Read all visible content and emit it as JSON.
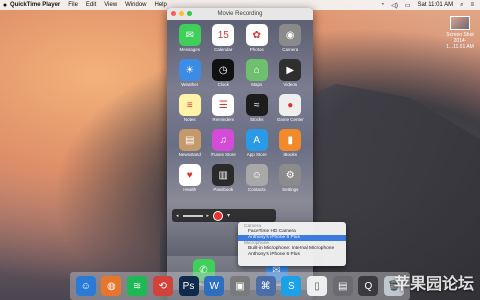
{
  "menubar": {
    "apple": "",
    "app": "QuickTime Player",
    "items": [
      "File",
      "Edit",
      "View",
      "Window",
      "Help"
    ],
    "clock": "Sat 11:01 AM"
  },
  "window": {
    "title": "Movie Recording"
  },
  "apps": [
    {
      "label": "Messages",
      "color": "#3fcf5a",
      "glyph": "✉"
    },
    {
      "label": "Calendar",
      "color": "#ffffff",
      "glyph": "15"
    },
    {
      "label": "Photos",
      "color": "#ffffff",
      "glyph": "✿"
    },
    {
      "label": "Camera",
      "color": "#8a8a8a",
      "glyph": "◉"
    },
    {
      "label": "Weather",
      "color": "#3c8ce6",
      "glyph": "☀"
    },
    {
      "label": "Clock",
      "color": "#111111",
      "glyph": "◷"
    },
    {
      "label": "Maps",
      "color": "#6ec06e",
      "glyph": "⌂"
    },
    {
      "label": "Videos",
      "color": "#2f2f2f",
      "glyph": "▶"
    },
    {
      "label": "Notes",
      "color": "#fff3a7",
      "glyph": "≡"
    },
    {
      "label": "Reminders",
      "color": "#ffffff",
      "glyph": "☰"
    },
    {
      "label": "Stocks",
      "color": "#1d1d1d",
      "glyph": "≈"
    },
    {
      "label": "Game Center",
      "color": "#eeeeee",
      "glyph": "●"
    },
    {
      "label": "Newsstand",
      "color": "#c49a6c",
      "glyph": "▤"
    },
    {
      "label": "iTunes Store",
      "color": "#d34bd6",
      "glyph": "♫"
    },
    {
      "label": "App Store",
      "color": "#2a9ae6",
      "glyph": "A"
    },
    {
      "label": "iBooks",
      "color": "#f08a2b",
      "glyph": "▮"
    },
    {
      "label": "Health",
      "color": "#ffffff",
      "glyph": "♥"
    },
    {
      "label": "Passbook",
      "color": "#2a2a2a",
      "glyph": "▥"
    },
    {
      "label": "Contacts",
      "color": "#a8a8a8",
      "glyph": "☺"
    },
    {
      "label": "Settings",
      "color": "#8b8b8b",
      "glyph": "⚙"
    }
  ],
  "dock_apps": [
    {
      "label": "Phone",
      "color": "#3fcf5a",
      "glyph": "✆"
    },
    {
      "label": "Mail",
      "color": "#3c8ce6",
      "glyph": "✉"
    }
  ],
  "recording_menu": {
    "camera_header": "Camera",
    "cameras": [
      "FaceTime HD Camera",
      "Anthony's iPhone 6 Plus"
    ],
    "mic_header": "Microphone",
    "mics": [
      "Built-in Microphone: Internal Microphone",
      "Anthony's iPhone 6 Plus"
    ]
  },
  "desktop_file": {
    "name": "Screen Shot",
    "date": "2014-1...11.01 AM"
  },
  "watermark": "苹果园论坛"
}
